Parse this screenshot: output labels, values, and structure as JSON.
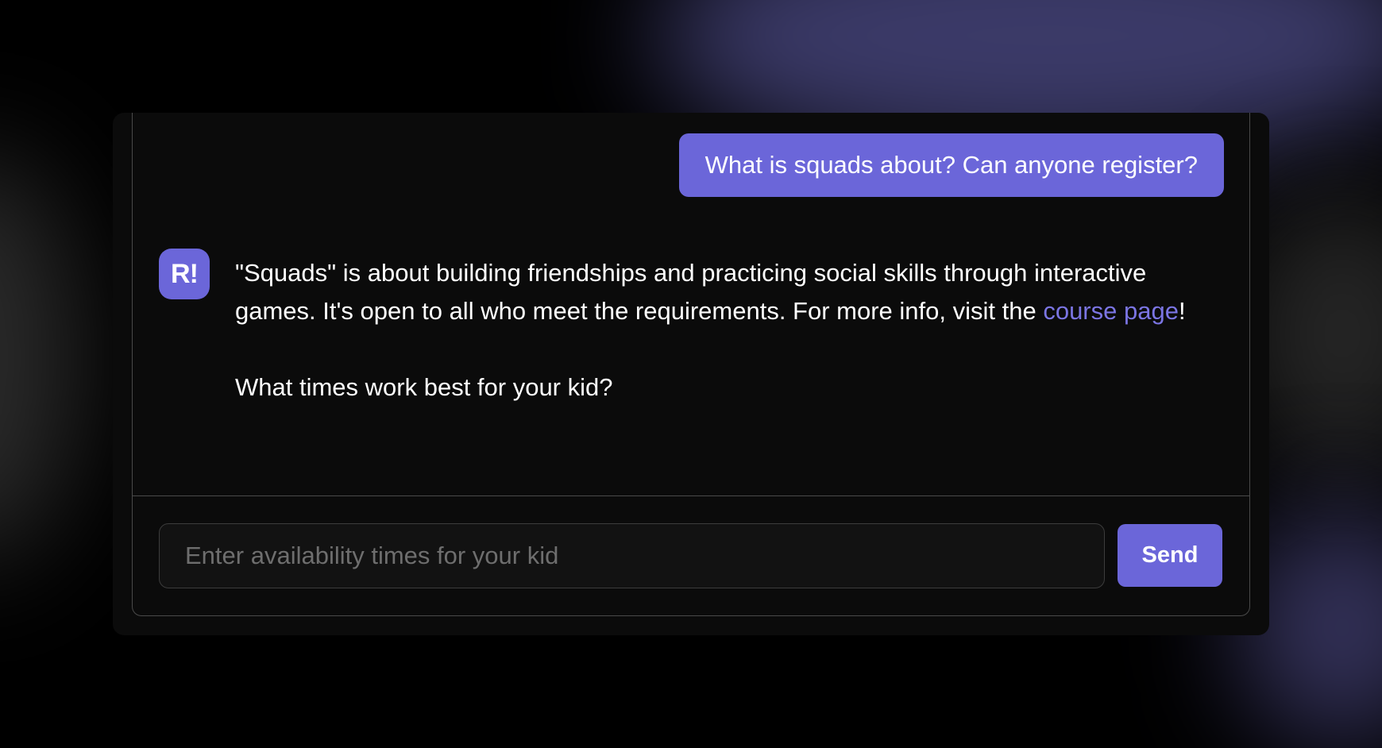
{
  "chat": {
    "user_message": "What is squads about? Can anyone register?",
    "bot": {
      "avatar_text": "R!",
      "reply_line1_prefix": "\"Squads\" is about building friendships and practicing social skills through interactive games. It's open to all who meet the requirements. For more info, visit the ",
      "reply_link_text": "course page",
      "reply_line1_suffix": "!",
      "reply_line2": "What times work best for your kid?"
    }
  },
  "composer": {
    "placeholder": "Enter availability times for your kid",
    "value": "",
    "send_label": "Send"
  },
  "colors": {
    "accent": "#6b66d9",
    "link": "#7b75e3",
    "card_background": "#0b0b0b",
    "border": "#4a4a4a"
  }
}
